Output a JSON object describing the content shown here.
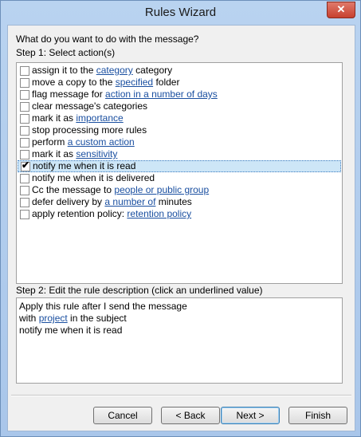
{
  "window": {
    "title": "Rules Wizard",
    "close_symbol": "✕"
  },
  "prompt": "What do you want to do with the message?",
  "step1_label": "Step 1: Select action(s)",
  "actions": [
    {
      "checked": false,
      "parts": [
        {
          "text": "assign it to the "
        },
        {
          "text": "category",
          "link": true
        },
        {
          "text": " category"
        }
      ]
    },
    {
      "checked": false,
      "parts": [
        {
          "text": "move a copy to the "
        },
        {
          "text": "specified",
          "link": true
        },
        {
          "text": " folder"
        }
      ]
    },
    {
      "checked": false,
      "parts": [
        {
          "text": "flag message for "
        },
        {
          "text": "action in a number of days",
          "link": true
        }
      ]
    },
    {
      "checked": false,
      "parts": [
        {
          "text": "clear message's categories"
        }
      ]
    },
    {
      "checked": false,
      "parts": [
        {
          "text": "mark it as "
        },
        {
          "text": "importance",
          "link": true
        }
      ]
    },
    {
      "checked": false,
      "parts": [
        {
          "text": "stop processing more rules"
        }
      ]
    },
    {
      "checked": false,
      "parts": [
        {
          "text": "perform "
        },
        {
          "text": "a custom action",
          "link": true
        }
      ]
    },
    {
      "checked": false,
      "parts": [
        {
          "text": "mark it as "
        },
        {
          "text": "sensitivity",
          "link": true
        }
      ]
    },
    {
      "checked": true,
      "selected": true,
      "parts": [
        {
          "text": "notify me when it is read"
        }
      ]
    },
    {
      "checked": false,
      "parts": [
        {
          "text": "notify me when it is delivered"
        }
      ]
    },
    {
      "checked": false,
      "parts": [
        {
          "text": "Cc the message to "
        },
        {
          "text": "people or public group",
          "link": true
        }
      ]
    },
    {
      "checked": false,
      "parts": [
        {
          "text": "defer delivery by "
        },
        {
          "text": "a number of",
          "link": true
        },
        {
          "text": " minutes"
        }
      ]
    },
    {
      "checked": false,
      "parts": [
        {
          "text": "apply retention policy: "
        },
        {
          "text": "retention policy",
          "link": true
        }
      ]
    }
  ],
  "step2_label": "Step 2: Edit the rule description (click an underlined value)",
  "description": [
    {
      "parts": [
        {
          "text": "Apply this rule after I send the message"
        }
      ]
    },
    {
      "parts": [
        {
          "text": "with "
        },
        {
          "text": "project",
          "link": true
        },
        {
          "text": " in the subject"
        }
      ]
    },
    {
      "parts": [
        {
          "text": "notify me when it is read"
        }
      ]
    }
  ],
  "buttons": {
    "cancel": "Cancel",
    "back": "< Back",
    "next": "Next >",
    "finish": "Finish"
  },
  "check_glyph": "✔"
}
